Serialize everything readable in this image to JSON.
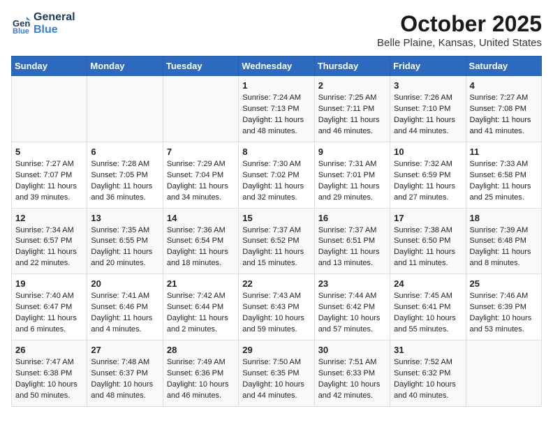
{
  "logo": {
    "line1": "General",
    "line2": "Blue"
  },
  "title": "October 2025",
  "location": "Belle Plaine, Kansas, United States",
  "days_of_week": [
    "Sunday",
    "Monday",
    "Tuesday",
    "Wednesday",
    "Thursday",
    "Friday",
    "Saturday"
  ],
  "weeks": [
    [
      {
        "day": "",
        "info": ""
      },
      {
        "day": "",
        "info": ""
      },
      {
        "day": "",
        "info": ""
      },
      {
        "day": "1",
        "info": "Sunrise: 7:24 AM\nSunset: 7:13 PM\nDaylight: 11 hours\nand 48 minutes."
      },
      {
        "day": "2",
        "info": "Sunrise: 7:25 AM\nSunset: 7:11 PM\nDaylight: 11 hours\nand 46 minutes."
      },
      {
        "day": "3",
        "info": "Sunrise: 7:26 AM\nSunset: 7:10 PM\nDaylight: 11 hours\nand 44 minutes."
      },
      {
        "day": "4",
        "info": "Sunrise: 7:27 AM\nSunset: 7:08 PM\nDaylight: 11 hours\nand 41 minutes."
      }
    ],
    [
      {
        "day": "5",
        "info": "Sunrise: 7:27 AM\nSunset: 7:07 PM\nDaylight: 11 hours\nand 39 minutes."
      },
      {
        "day": "6",
        "info": "Sunrise: 7:28 AM\nSunset: 7:05 PM\nDaylight: 11 hours\nand 36 minutes."
      },
      {
        "day": "7",
        "info": "Sunrise: 7:29 AM\nSunset: 7:04 PM\nDaylight: 11 hours\nand 34 minutes."
      },
      {
        "day": "8",
        "info": "Sunrise: 7:30 AM\nSunset: 7:02 PM\nDaylight: 11 hours\nand 32 minutes."
      },
      {
        "day": "9",
        "info": "Sunrise: 7:31 AM\nSunset: 7:01 PM\nDaylight: 11 hours\nand 29 minutes."
      },
      {
        "day": "10",
        "info": "Sunrise: 7:32 AM\nSunset: 6:59 PM\nDaylight: 11 hours\nand 27 minutes."
      },
      {
        "day": "11",
        "info": "Sunrise: 7:33 AM\nSunset: 6:58 PM\nDaylight: 11 hours\nand 25 minutes."
      }
    ],
    [
      {
        "day": "12",
        "info": "Sunrise: 7:34 AM\nSunset: 6:57 PM\nDaylight: 11 hours\nand 22 minutes."
      },
      {
        "day": "13",
        "info": "Sunrise: 7:35 AM\nSunset: 6:55 PM\nDaylight: 11 hours\nand 20 minutes."
      },
      {
        "day": "14",
        "info": "Sunrise: 7:36 AM\nSunset: 6:54 PM\nDaylight: 11 hours\nand 18 minutes."
      },
      {
        "day": "15",
        "info": "Sunrise: 7:37 AM\nSunset: 6:52 PM\nDaylight: 11 hours\nand 15 minutes."
      },
      {
        "day": "16",
        "info": "Sunrise: 7:37 AM\nSunset: 6:51 PM\nDaylight: 11 hours\nand 13 minutes."
      },
      {
        "day": "17",
        "info": "Sunrise: 7:38 AM\nSunset: 6:50 PM\nDaylight: 11 hours\nand 11 minutes."
      },
      {
        "day": "18",
        "info": "Sunrise: 7:39 AM\nSunset: 6:48 PM\nDaylight: 11 hours\nand 8 minutes."
      }
    ],
    [
      {
        "day": "19",
        "info": "Sunrise: 7:40 AM\nSunset: 6:47 PM\nDaylight: 11 hours\nand 6 minutes."
      },
      {
        "day": "20",
        "info": "Sunrise: 7:41 AM\nSunset: 6:46 PM\nDaylight: 11 hours\nand 4 minutes."
      },
      {
        "day": "21",
        "info": "Sunrise: 7:42 AM\nSunset: 6:44 PM\nDaylight: 11 hours\nand 2 minutes."
      },
      {
        "day": "22",
        "info": "Sunrise: 7:43 AM\nSunset: 6:43 PM\nDaylight: 10 hours\nand 59 minutes."
      },
      {
        "day": "23",
        "info": "Sunrise: 7:44 AM\nSunset: 6:42 PM\nDaylight: 10 hours\nand 57 minutes."
      },
      {
        "day": "24",
        "info": "Sunrise: 7:45 AM\nSunset: 6:41 PM\nDaylight: 10 hours\nand 55 minutes."
      },
      {
        "day": "25",
        "info": "Sunrise: 7:46 AM\nSunset: 6:39 PM\nDaylight: 10 hours\nand 53 minutes."
      }
    ],
    [
      {
        "day": "26",
        "info": "Sunrise: 7:47 AM\nSunset: 6:38 PM\nDaylight: 10 hours\nand 50 minutes."
      },
      {
        "day": "27",
        "info": "Sunrise: 7:48 AM\nSunset: 6:37 PM\nDaylight: 10 hours\nand 48 minutes."
      },
      {
        "day": "28",
        "info": "Sunrise: 7:49 AM\nSunset: 6:36 PM\nDaylight: 10 hours\nand 46 minutes."
      },
      {
        "day": "29",
        "info": "Sunrise: 7:50 AM\nSunset: 6:35 PM\nDaylight: 10 hours\nand 44 minutes."
      },
      {
        "day": "30",
        "info": "Sunrise: 7:51 AM\nSunset: 6:33 PM\nDaylight: 10 hours\nand 42 minutes."
      },
      {
        "day": "31",
        "info": "Sunrise: 7:52 AM\nSunset: 6:32 PM\nDaylight: 10 hours\nand 40 minutes."
      },
      {
        "day": "",
        "info": ""
      }
    ]
  ]
}
